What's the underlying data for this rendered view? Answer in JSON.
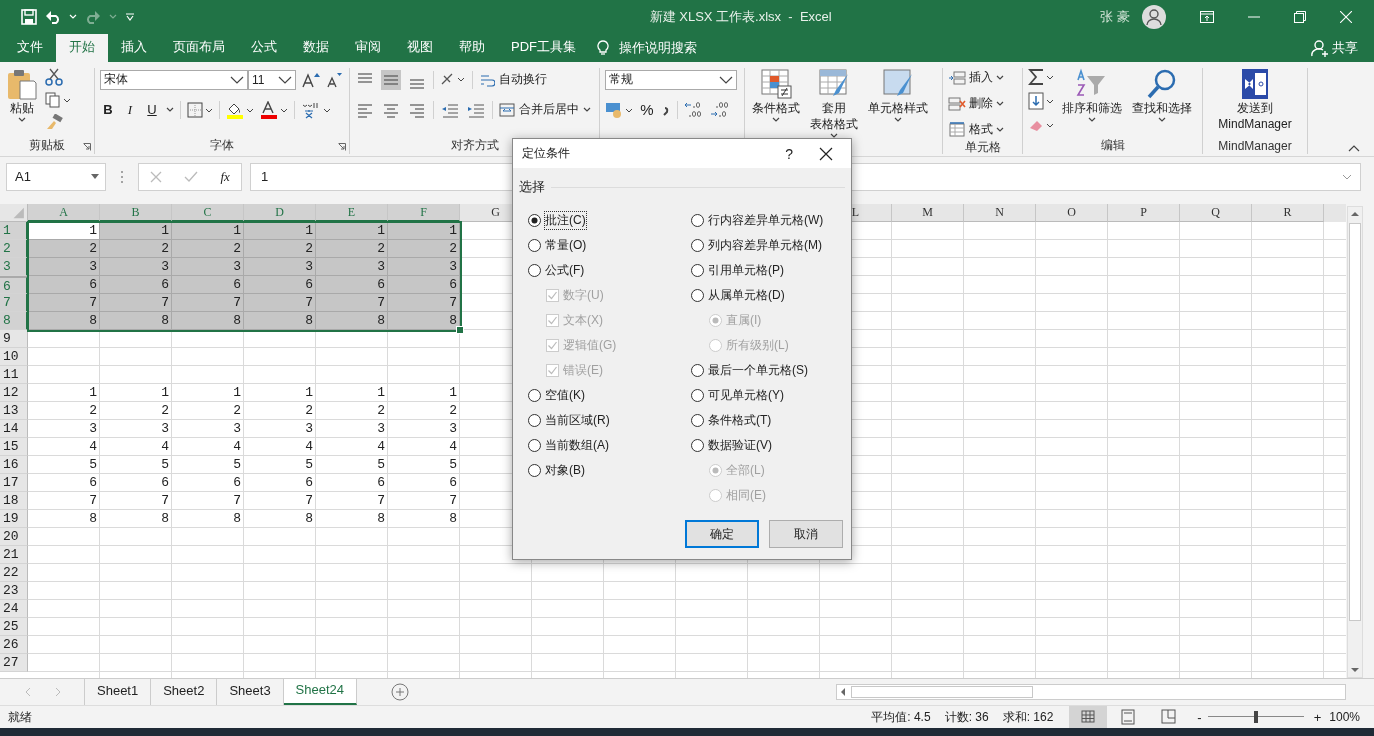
{
  "window": {
    "title": "新建 XLSX 工作表.xlsx  -  Excel",
    "user": "张 豪"
  },
  "tabs": [
    {
      "label": "文件",
      "selected": false
    },
    {
      "label": "开始",
      "selected": true
    },
    {
      "label": "插入",
      "selected": false
    },
    {
      "label": "页面布局",
      "selected": false
    },
    {
      "label": "公式",
      "selected": false
    },
    {
      "label": "数据",
      "selected": false
    },
    {
      "label": "审阅",
      "selected": false
    },
    {
      "label": "视图",
      "selected": false
    },
    {
      "label": "帮助",
      "selected": false
    },
    {
      "label": "PDF工具集",
      "selected": false
    }
  ],
  "tell_me": "操作说明搜索",
  "share": "共享",
  "ribbon": {
    "clipboard": {
      "label": "剪贴板",
      "paste": "粘贴"
    },
    "font": {
      "label": "字体",
      "font_name": "宋体",
      "font_size": "11",
      "bold": "B",
      "italic": "I",
      "underline": "U"
    },
    "alignment": {
      "label": "对齐方式",
      "wrap": "自动换行",
      "merge": "合并后居中"
    },
    "number": {
      "format": "常规",
      "percent": "%"
    },
    "styles": {
      "conditional": "条件格式",
      "table": [
        "套用",
        "表格格式"
      ],
      "cell_styles": "单元格样式"
    },
    "cells": {
      "label": "单元格",
      "insert": "插入",
      "delete": "删除",
      "format": "格式"
    },
    "editing": {
      "label": "编辑",
      "sort": "排序和筛选",
      "find": "查找和选择"
    },
    "mindmanager": {
      "label": "MindManager",
      "send": [
        "发送到",
        "MindManager"
      ]
    }
  },
  "formula_bar": {
    "name_box": "A1",
    "function_label": "fx",
    "value": "1"
  },
  "sheet": {
    "columns": [
      {
        "label": "A",
        "selected": true
      },
      {
        "label": "B",
        "selected": true
      },
      {
        "label": "C",
        "selected": true
      },
      {
        "label": "D",
        "selected": true
      },
      {
        "label": "E",
        "selected": true
      },
      {
        "label": "F",
        "selected": true
      },
      {
        "label": "G",
        "selected": false
      }
    ],
    "columns_right": [
      {
        "label": "L",
        "selected": false
      },
      {
        "label": "M",
        "selected": false
      },
      {
        "label": "N",
        "selected": false
      },
      {
        "label": "O",
        "selected": false
      },
      {
        "label": "P",
        "selected": false
      },
      {
        "label": "Q",
        "selected": false
      },
      {
        "label": "R",
        "selected": false
      }
    ],
    "rows": [
      {
        "label": "1",
        "selected": true,
        "cells": [
          "1",
          "1",
          "1",
          "1",
          "1",
          "1"
        ]
      },
      {
        "label": "2",
        "selected": true,
        "cells": [
          "2",
          "2",
          "2",
          "2",
          "2",
          "2"
        ]
      },
      {
        "label": "3",
        "selected": true,
        "cells": [
          "3",
          "3",
          "3",
          "3",
          "3",
          "3"
        ]
      },
      {
        "label": "6",
        "selected": true,
        "cells": [
          "6",
          "6",
          "6",
          "6",
          "6",
          "6"
        ]
      },
      {
        "label": "7",
        "selected": true,
        "cells": [
          "7",
          "7",
          "7",
          "7",
          "7",
          "7"
        ]
      },
      {
        "label": "8",
        "selected": true,
        "cells": [
          "8",
          "8",
          "8",
          "8",
          "8",
          "8"
        ]
      },
      {
        "label": "9",
        "selected": false
      },
      {
        "label": "10",
        "selected": false
      },
      {
        "label": "11",
        "selected": false
      },
      {
        "label": "12",
        "selected": false,
        "cells": [
          "1",
          "1",
          "1",
          "1",
          "1",
          "1"
        ]
      },
      {
        "label": "13",
        "selected": false,
        "cells": [
          "2",
          "2",
          "2",
          "2",
          "2",
          "2"
        ]
      },
      {
        "label": "14",
        "selected": false,
        "cells": [
          "3",
          "3",
          "3",
          "3",
          "3",
          "3"
        ]
      },
      {
        "label": "15",
        "selected": false,
        "cells": [
          "4",
          "4",
          "4",
          "4",
          "4",
          "4"
        ]
      },
      {
        "label": "16",
        "selected": false,
        "cells": [
          "5",
          "5",
          "5",
          "5",
          "5",
          "5"
        ]
      },
      {
        "label": "17",
        "selected": false,
        "cells": [
          "6",
          "6",
          "6",
          "6",
          "6",
          "6"
        ]
      },
      {
        "label": "18",
        "selected": false,
        "cells": [
          "7",
          "7",
          "7",
          "7",
          "7",
          "7"
        ]
      },
      {
        "label": "19",
        "selected": false,
        "cells": [
          "8",
          "8",
          "8",
          "8",
          "8",
          "8"
        ]
      },
      {
        "label": "20",
        "selected": false
      },
      {
        "label": "21",
        "selected": false
      },
      {
        "label": "22",
        "selected": false
      },
      {
        "label": "23",
        "selected": false
      },
      {
        "label": "24",
        "selected": false
      },
      {
        "label": "25",
        "selected": false
      },
      {
        "label": "26",
        "selected": false
      },
      {
        "label": "27",
        "selected": false
      }
    ]
  },
  "sheet_tabs": [
    {
      "label": "Sheet1",
      "selected": false
    },
    {
      "label": "Sheet2",
      "selected": false
    },
    {
      "label": "Sheet3",
      "selected": false
    },
    {
      "label": "Sheet24",
      "selected": true
    }
  ],
  "status_bar": {
    "ready": "就绪",
    "average": "平均值: 4.5",
    "count": "计数: 36",
    "sum": "求和: 162",
    "zoom_out": "-",
    "zoom_in": "+",
    "zoom": "100%",
    "zoom_slider": {
      "level": 0.5
    }
  },
  "dialog": {
    "title": "定位条件",
    "help": "?",
    "section": "选择",
    "left": [
      {
        "label": "批注(C)",
        "kind": "radio",
        "selected": true,
        "disabled": false
      },
      {
        "label": "常量(O)",
        "kind": "radio",
        "selected": false,
        "disabled": false
      },
      {
        "label": "公式(F)",
        "kind": "radio",
        "selected": false,
        "disabled": false,
        "children": [
          {
            "label": "数字(U)",
            "kind": "checkbox",
            "checked": true,
            "disabled": true
          },
          {
            "label": "文本(X)",
            "kind": "checkbox",
            "checked": true,
            "disabled": true
          },
          {
            "label": "逻辑值(G)",
            "kind": "checkbox",
            "checked": true,
            "disabled": true
          },
          {
            "label": "错误(E)",
            "kind": "checkbox",
            "checked": true,
            "disabled": true
          }
        ]
      },
      {
        "label": "空值(K)",
        "kind": "radio",
        "selected": false,
        "disabled": false
      },
      {
        "label": "当前区域(R)",
        "kind": "radio",
        "selected": false,
        "disabled": false
      },
      {
        "label": "当前数组(A)",
        "kind": "radio",
        "selected": false,
        "disabled": false
      },
      {
        "label": "对象(B)",
        "kind": "radio",
        "selected": false,
        "disabled": false
      }
    ],
    "right": [
      {
        "label": "行内容差异单元格(W)",
        "kind": "radio",
        "selected": false,
        "disabled": false
      },
      {
        "label": "列内容差异单元格(M)",
        "kind": "radio",
        "selected": false,
        "disabled": false
      },
      {
        "label": "引用单元格(P)",
        "kind": "radio",
        "selected": false,
        "disabled": false
      },
      {
        "label": "从属单元格(D)",
        "kind": "radio",
        "selected": false,
        "disabled": false,
        "children": [
          {
            "label": "直属(I)",
            "kind": "radio",
            "selected": true,
            "disabled": true
          },
          {
            "label": "所有级别(L)",
            "kind": "radio",
            "selected": false,
            "disabled": true
          }
        ]
      },
      {
        "label": "最后一个单元格(S)",
        "kind": "radio",
        "selected": false,
        "disabled": false
      },
      {
        "label": "可见单元格(Y)",
        "kind": "radio",
        "selected": false,
        "disabled": false
      },
      {
        "label": "条件格式(T)",
        "kind": "radio",
        "selected": false,
        "disabled": false
      },
      {
        "label": "数据验证(V)",
        "kind": "radio",
        "selected": false,
        "disabled": false,
        "children": [
          {
            "label": "全部(L)",
            "kind": "radio",
            "selected": true,
            "disabled": true
          },
          {
            "label": "相同(E)",
            "kind": "radio",
            "selected": false,
            "disabled": true
          }
        ]
      }
    ],
    "buttons": [
      {
        "label": "确定",
        "default": true
      },
      {
        "label": "取消",
        "default": false
      }
    ]
  }
}
